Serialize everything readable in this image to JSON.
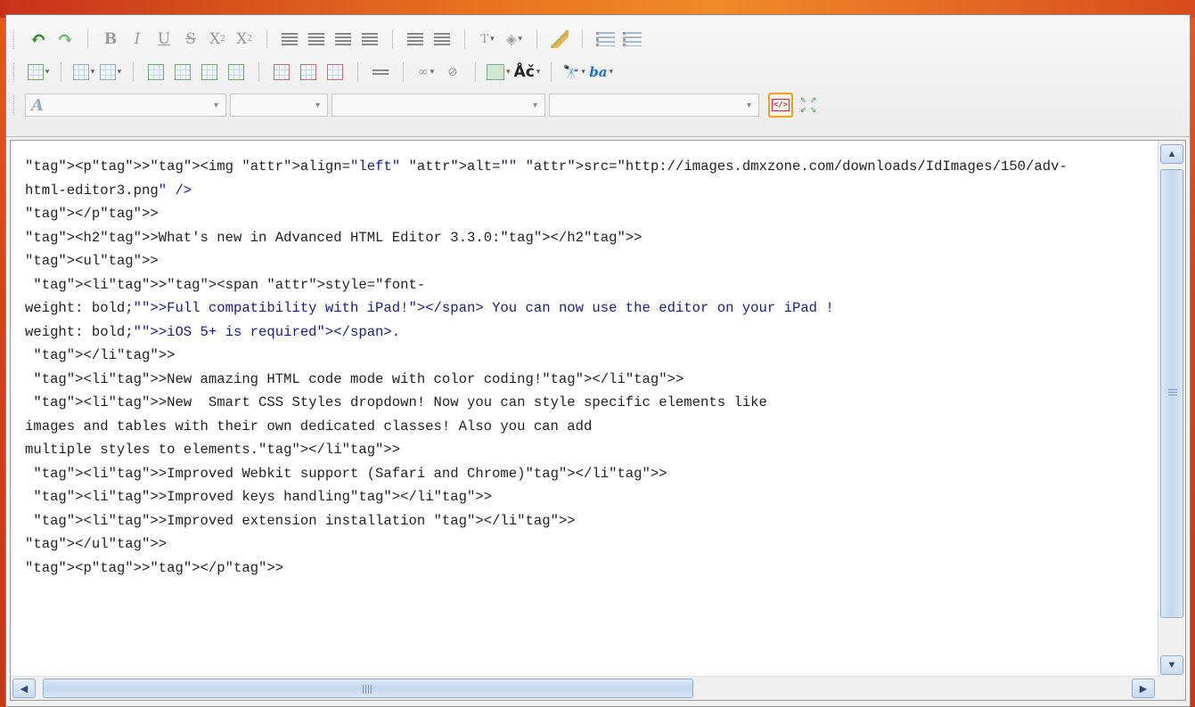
{
  "toolbar": {
    "row1": {
      "undo_icon": "undo-icon",
      "redo_icon": "redo-icon",
      "bold": "B",
      "italic": "I",
      "underline": "U",
      "strike": "S",
      "subscript": "X",
      "subscript_mark": "2",
      "superscript": "X",
      "superscript_mark": "2",
      "text_color": "T",
      "caret": "▾"
    },
    "row2": {
      "spellcheck_label": "Åč",
      "find_label": "🔭",
      "replace_label": "ba",
      "caret": "▾"
    },
    "row3": {
      "style_icon": "A",
      "style_value": "",
      "format_value": "",
      "font_value": "",
      "size_value": "",
      "caret": "▾",
      "source_label": "</>"
    }
  },
  "code": {
    "lines": [
      "<p><img align=\"left\" alt=\"\" src=\"http://images.dmxzone.com/downloads/IdImages/150/adv-",
      "html-editor3.png\" />",
      "</p>",
      "<h2>What's new in Advanced HTML Editor 3.3.0:</h2>",
      "<ul>",
      " <li><span style=\"font-",
      "weight: bold;\">Full compatibility with iPad!</span> You can now use the editor on your iPad !",
      "weight: bold;\">iOS 5+ is required</span>.",
      " </li>",
      " <li>New amazing HTML code mode with color coding!</li>",
      " <li>New  Smart CSS Styles dropdown! Now you can style specific elements like",
      "images and tables with their own dedicated classes! Also you can add",
      "multiple styles to elements.</li>",
      " <li>Improved Webkit support (Safari and Chrome)</li>",
      " <li>Improved keys handling</li>",
      " <li>Improved extension installation </li>",
      "</ul>",
      "<p></p>"
    ]
  },
  "scrollbars": {
    "up": "▲",
    "down": "▼",
    "left": "◀",
    "right": "▶"
  },
  "colors": {
    "background_orange": "#d7431a",
    "tag_color": "#1a1a8a",
    "source_highlight": "#f0a020"
  }
}
